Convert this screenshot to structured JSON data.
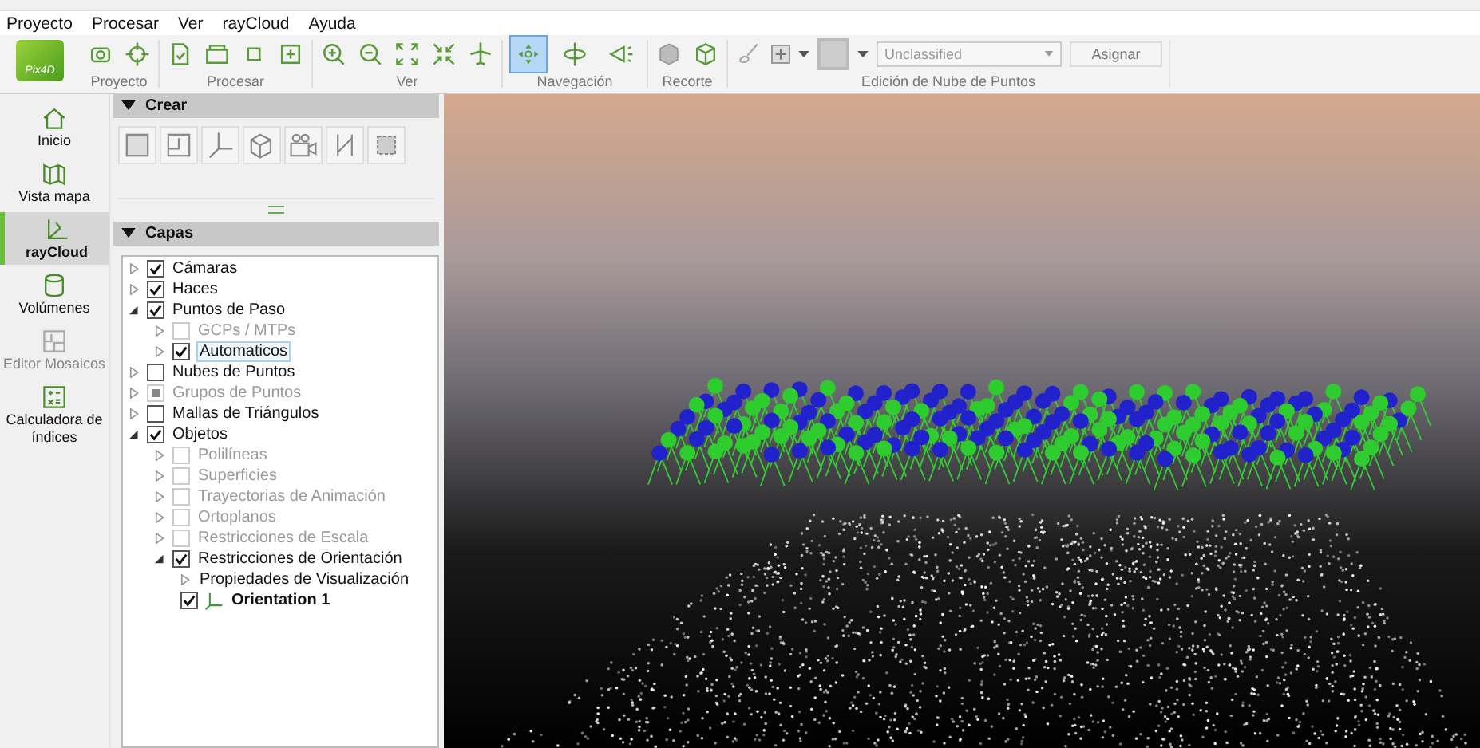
{
  "menu": [
    "Proyecto",
    "Procesar",
    "Ver",
    "rayCloud",
    "Ayuda"
  ],
  "logo": "Pix4D",
  "toolbar_groups": [
    {
      "kind": "proyecto",
      "label": "Proyecto"
    },
    {
      "kind": "procesar",
      "label": "Procesar"
    },
    {
      "kind": "ver",
      "label": "Ver"
    },
    {
      "kind": "navegacion",
      "label": "Navegación",
      "buttons": [
        {
          "selected": true
        },
        {
          "selected": false
        },
        {
          "selected": false
        }
      ]
    },
    {
      "kind": "recorte",
      "label": "Recorte"
    },
    {
      "kind": "edicion",
      "label": "Edición de Nube de Puntos",
      "class_select": "Unclassified",
      "assign_button": "Asignar"
    }
  ],
  "sidebar": [
    {
      "kind": "home",
      "label": "Inicio",
      "selected": false,
      "disabled": false
    },
    {
      "kind": "map",
      "label": "Vista mapa",
      "selected": false,
      "disabled": false
    },
    {
      "kind": "raycloud",
      "label": "rayCloud",
      "selected": true,
      "disabled": false
    },
    {
      "kind": "volumes",
      "label": "Volúmenes",
      "selected": false,
      "disabled": false
    },
    {
      "kind": "mosaic",
      "label": "Editor Mosaicos",
      "selected": false,
      "disabled": true
    },
    {
      "kind": "calculator",
      "label": "Calculadora de índices",
      "selected": false,
      "disabled": false
    }
  ],
  "crear_panel": {
    "title": "Crear",
    "expanded": true
  },
  "capas_panel": {
    "title": "Capas",
    "expanded": true
  },
  "layers": [
    {
      "label": "Cámaras",
      "checked": true,
      "disabled": false,
      "expanded": false,
      "selected": false
    },
    {
      "label": "Haces",
      "checked": true,
      "disabled": false,
      "expanded": false,
      "selected": false
    },
    {
      "label": "Puntos de Paso",
      "checked": true,
      "disabled": false,
      "expanded": true,
      "selected": false,
      "children": [
        {
          "label": "GCPs / MTPs",
          "checked": false,
          "disabled": true,
          "expanded": false,
          "selected": false
        },
        {
          "label": "Automaticos",
          "checked": true,
          "disabled": false,
          "expanded": false,
          "selected": true
        }
      ]
    },
    {
      "label": "Nubes de Puntos",
      "checked": false,
      "disabled": false,
      "expanded": false,
      "selected": false
    },
    {
      "label": "Grupos de Puntos",
      "partial": true,
      "disabled": true,
      "expanded": false,
      "selected": false
    },
    {
      "label": "Mallas de Triángulos",
      "checked": false,
      "disabled": false,
      "expanded": false,
      "selected": false
    },
    {
      "label": "Objetos",
      "checked": true,
      "disabled": false,
      "expanded": true,
      "selected": false,
      "children": [
        {
          "label": "Polilíneas",
          "checked": false,
          "disabled": true,
          "expanded": false,
          "selected": false
        },
        {
          "label": "Superficies",
          "checked": false,
          "disabled": true,
          "expanded": false,
          "selected": false
        },
        {
          "label": "Trayectorias de Animación",
          "checked": false,
          "disabled": true,
          "expanded": false,
          "selected": false
        },
        {
          "label": "Ortoplanos",
          "checked": false,
          "disabled": true,
          "expanded": false,
          "selected": false
        },
        {
          "label": "Restricciones de Escala",
          "checked": false,
          "disabled": true,
          "expanded": false,
          "selected": false
        },
        {
          "label": "Restricciones de Orientación",
          "checked": true,
          "disabled": false,
          "expanded": true,
          "selected": false,
          "children": [
            {
              "kind": "folder",
              "label": "Propiedades de Visualización",
              "expanded": false
            },
            {
              "kind": "object",
              "label": "Orientation 1",
              "checked": true
            }
          ]
        }
      ]
    }
  ]
}
